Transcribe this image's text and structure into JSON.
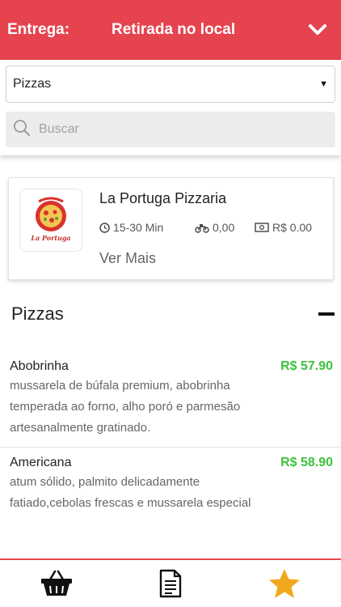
{
  "header": {
    "delivery_label": "Entrega:",
    "delivery_mode": "Retirada no local",
    "expand_icon": "chevron-down-icon"
  },
  "filters": {
    "category_selected": "Pizzas",
    "search_placeholder": "Buscar"
  },
  "store": {
    "name": "La Portuga Pizzaria",
    "time": "15-30 Min",
    "delivery_fee": "0,00",
    "min_order": "R$ 0.00",
    "more_link": "Ver Mais",
    "logo_text": "La Portuga"
  },
  "section": {
    "title": "Pizzas"
  },
  "products": [
    {
      "name": "Abobrinha",
      "price": "R$ 57.90",
      "description": "mussarela de búfala premium, abobrinha temperada ao forno, alho poró e parmesão artesanalmente gratinado."
    },
    {
      "name": "Americana",
      "price": "R$ 58.90",
      "description": "atum sólido, palmito delicadamente fatiado,cebolas frescas e mussarela especial"
    }
  ],
  "bottom_nav": {
    "items": [
      "basket-icon",
      "document-icon",
      "star-icon"
    ]
  },
  "colors": {
    "brand": "#e5444f",
    "price": "#3ec23e",
    "star": "#f2a81d"
  }
}
